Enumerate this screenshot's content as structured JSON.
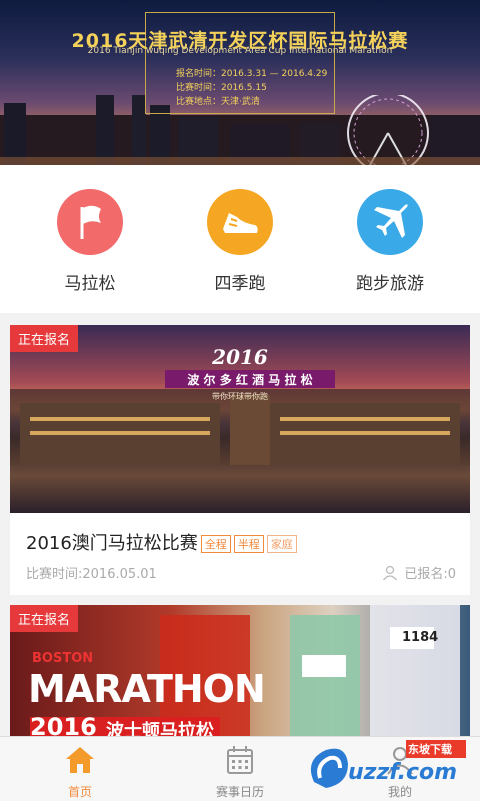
{
  "banner": {
    "title": "2016天津武清开发区杯国际马拉松赛",
    "subtitle": "2016 Tianjin wuqing Development Area Cup International Marathon",
    "signup_time": "报名时间：2016.3.31 — 2016.4.29",
    "race_time": "比赛时间：2016.5.15",
    "location": "比赛地点：天津·武清"
  },
  "categories": [
    {
      "label": "马拉松",
      "icon": "flag-icon",
      "color": "#f26a6a"
    },
    {
      "label": "四季跑",
      "icon": "running-shoe-icon",
      "color": "#f5a623"
    },
    {
      "label": "跑步旅游",
      "icon": "airplane-icon",
      "color": "#3aa9e8"
    }
  ],
  "events": [
    {
      "status": "正在报名",
      "image_text_year": "2016",
      "image_text_title": "波 尔 多 红 酒 马 拉 松",
      "image_text_sub": "带你环球带你跑",
      "title": "2016澳门马拉松比赛",
      "tags": [
        "全程",
        "半程",
        "家庭"
      ],
      "date": "比赛时间:2016.05.01",
      "signed": "已报名:0"
    },
    {
      "status": "正在报名",
      "image_text_city": "BOSTON",
      "image_text_main": "MARATHON",
      "image_text_year": "2016",
      "image_text_cn": "波士顿马拉松",
      "bib_1": "1184"
    }
  ],
  "nav": [
    {
      "label": "首页",
      "icon": "home-icon",
      "active": true
    },
    {
      "label": "赛事日历",
      "icon": "calendar-icon",
      "active": false
    },
    {
      "label": "我的",
      "icon": "user-icon",
      "active": false
    }
  ],
  "watermark": {
    "text": "uzzf.com",
    "small": "东坡下载"
  },
  "colors": {
    "accent": "#f08a3c",
    "status_red": "#e5393b"
  }
}
